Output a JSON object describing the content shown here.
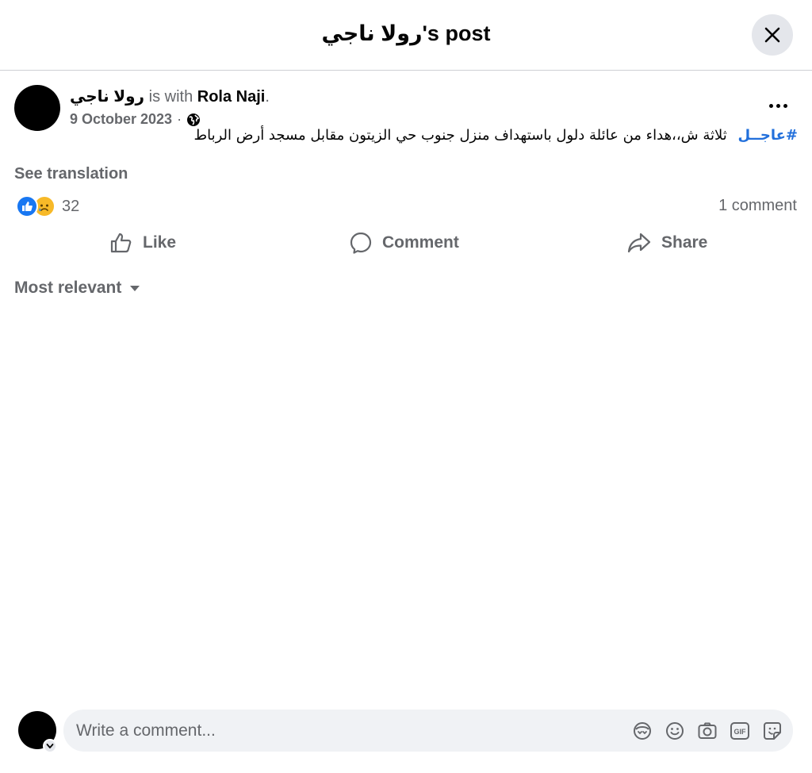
{
  "header": {
    "title": "رولا ناجي's post",
    "close_icon": "close-icon"
  },
  "post": {
    "author_name": "رولا ناجي",
    "with_text": " is with ",
    "tagged_name": "Rola Naji",
    "period": ".",
    "date": "9 October 2023",
    "separator": "·",
    "privacy_icon": "globe-icon",
    "hashtag": "#عاجــل",
    "text": "ثلاثة ش،،هداء من عائلة دلول باستهداف منزل جنوب حي الزيتون مقابل مسجد أرض الرباط",
    "see_translation": "See translation",
    "reaction_count": "32",
    "reaction_icons": [
      "like-icon",
      "sad-icon"
    ],
    "comment_count": "1 comment"
  },
  "actions": {
    "like_label": "Like",
    "comment_label": "Comment",
    "share_label": "Share"
  },
  "comments": {
    "sort_label": "Most relevant"
  },
  "composer": {
    "placeholder": "Write a comment...",
    "tools": [
      "avatar-sticker-icon",
      "emoji-icon",
      "camera-icon",
      "gif-icon",
      "sticker-icon"
    ]
  },
  "colors": {
    "accent": "#1877f2",
    "hashtag": "#216fdb",
    "secondary_text": "#65676b"
  }
}
